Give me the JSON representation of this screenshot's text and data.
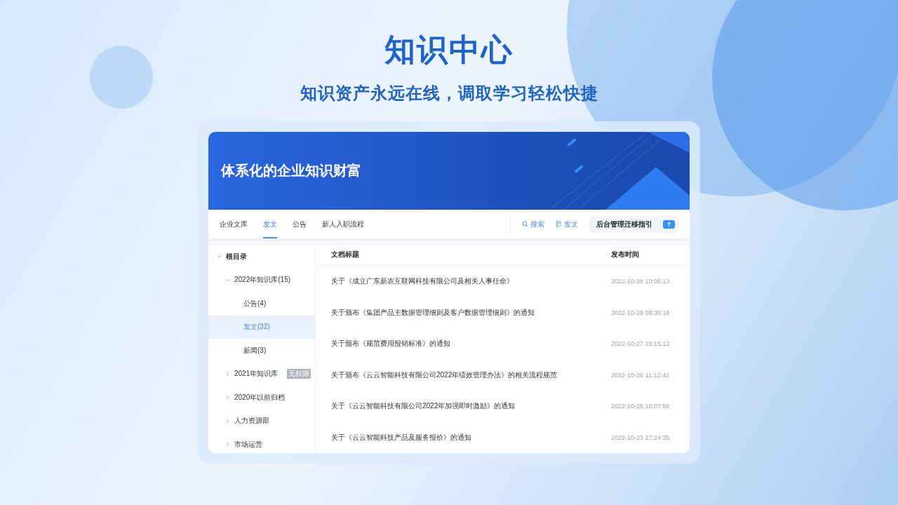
{
  "hero": {
    "title": "知识中心",
    "subtitle": "知识资产永远在线，调取学习轻松快捷"
  },
  "banner": {
    "title": "体系化的企业知识财富"
  },
  "tabs": [
    {
      "label": "企业文库",
      "selected": false
    },
    {
      "label": "发文",
      "selected": true
    },
    {
      "label": "公告",
      "selected": false
    },
    {
      "label": "新人入职流程",
      "selected": false
    }
  ],
  "actions": [
    {
      "kind": "search",
      "label": "搜索"
    },
    {
      "kind": "post",
      "label": "发文"
    }
  ],
  "guide_button": {
    "label": "后台管理迁移指引",
    "badge": "?"
  },
  "tree": [
    {
      "label": "根目录",
      "expanded": true,
      "selected": false,
      "children": [
        {
          "label": "2022年知识库(15)",
          "expanded": true,
          "selected": false,
          "children": [
            {
              "label": "公告(4)",
              "selected": false
            },
            {
              "label": "发文(32)",
              "selected": true
            },
            {
              "label": "新闻(3)",
              "selected": false
            }
          ]
        },
        {
          "label": "2021年知识库",
          "expanded": false,
          "selected": false,
          "badge": "无权限"
        },
        {
          "label": "2020年以前归档",
          "expanded": false,
          "selected": false
        },
        {
          "label": "人力资源部",
          "expanded": false,
          "selected": false
        },
        {
          "label": "市场运营",
          "expanded": false,
          "selected": false
        }
      ]
    }
  ],
  "table": {
    "columns": [
      "文档标题",
      "发布时间"
    ],
    "rows": [
      [
        "关于《成立广东新农互联网科技有限公司及相关人事任命》",
        "2022-10-28 10:06:13"
      ],
      [
        "关于颁布《集团产品主数据管理细则及客户数据管理细则》的通知",
        "2022-10-28 09:30:16"
      ],
      [
        "关于颁布《规范费用报销标准》的通知",
        "2022-10-27 15:15:13"
      ],
      [
        "关于颁布《云云智能科技有限公司2022年绩效管理办法》的相关流程规范",
        "2022-10-26 11:12:42"
      ],
      [
        "关于《云云智能科技有限公司2022年加强即时激励》的通知",
        "2022-10-26 10:07:56"
      ],
      [
        "关于《云云智能科技产品及服务报价》的通知",
        "2022-10-23 17:24:35"
      ]
    ]
  }
}
